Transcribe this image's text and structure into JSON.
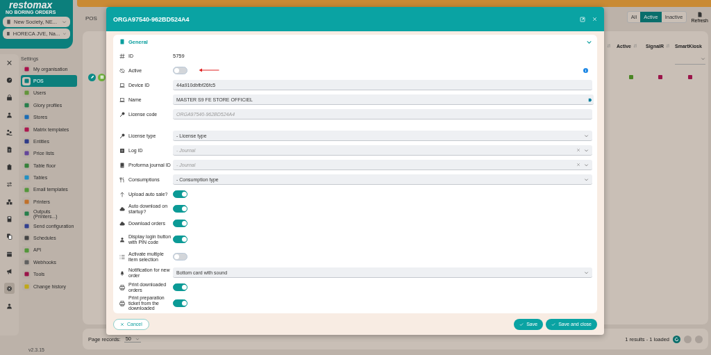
{
  "logo": {
    "name": "restomax",
    "tagline": "NO BORING ORDERS"
  },
  "selectors": [
    {
      "value": "New Society, NE..."
    },
    {
      "value": "HORECA JVE, Na..."
    }
  ],
  "rail_items": [
    {
      "selected": false
    },
    {
      "selected": false
    },
    {
      "selected": false
    },
    {
      "selected": false
    },
    {
      "selected": false
    },
    {
      "selected": false
    },
    {
      "selected": false
    },
    {
      "selected": false
    },
    {
      "selected": false
    },
    {
      "selected": false
    },
    {
      "selected": false
    },
    {
      "selected": false
    },
    {
      "selected": false
    },
    {
      "selected": true
    },
    {
      "selected": false
    }
  ],
  "nav": {
    "heading": "Settings",
    "items": [
      {
        "label": "My organisation",
        "color": "#a8104a",
        "selected": false
      },
      {
        "label": "POS",
        "color": "#0c7f7c",
        "selected": true
      },
      {
        "label": "Users",
        "color": "#62953a",
        "selected": false
      },
      {
        "label": "Glory profiles",
        "color": "#267e4b",
        "selected": false
      },
      {
        "label": "Stores",
        "color": "#1a6cb5",
        "selected": false
      },
      {
        "label": "Matrix templates",
        "color": "#ab174e",
        "selected": false
      },
      {
        "label": "Entities",
        "color": "#2e3b88",
        "selected": false
      },
      {
        "label": "Price lists",
        "color": "#64469a",
        "selected": false
      },
      {
        "label": "Table floor",
        "color": "#35803a",
        "selected": false
      },
      {
        "label": "Tables",
        "color": "#2290c2",
        "selected": false
      },
      {
        "label": "Email templates",
        "color": "#52963a",
        "selected": false
      },
      {
        "label": "Printers",
        "color": "#c0702a",
        "selected": false
      },
      {
        "label": "Outputs (Printers...)",
        "color": "#267e4b",
        "selected": false
      },
      {
        "label": "Send configuration",
        "color": "#32408f",
        "selected": false
      },
      {
        "label": "Schedules",
        "color": "#444444",
        "selected": false
      },
      {
        "label": "API",
        "color": "#52963a",
        "selected": false
      },
      {
        "label": "Webhooks",
        "color": "#606060",
        "selected": false
      },
      {
        "label": "Tools",
        "color": "#9a1449",
        "selected": false
      },
      {
        "label": "Change history",
        "color": "#c0a818",
        "selected": false
      }
    ]
  },
  "version": "v2.3.15",
  "page": {
    "tab": "POS",
    "filters": [
      {
        "label": "All",
        "selected": false
      },
      {
        "label": "Active",
        "selected": true
      },
      {
        "label": "Inactive",
        "selected": false
      }
    ],
    "refresh": "Refresh",
    "table": {
      "columns": [
        "Active",
        "SignalR",
        "SmartKiosk"
      ],
      "rows": [
        {
          "active": true,
          "signalr": false,
          "smartkiosk": false
        }
      ]
    },
    "footer": {
      "page_records_label": "Page records:",
      "page_records": "50",
      "results": "1 results - 1 loaded"
    }
  },
  "modal": {
    "title": "ORGA97540-962BD524A4",
    "section": {
      "title": "General",
      "expanded": true
    },
    "field_groups": [
      [
        {
          "kind": "static",
          "label": "ID",
          "value": "5759"
        },
        {
          "kind": "toggle",
          "label": "Active",
          "on": false,
          "info": true,
          "annotated": true
        },
        {
          "kind": "input",
          "label": "Device ID",
          "value": "44a910dbfbf26fc5"
        },
        {
          "kind": "input",
          "label": "Name",
          "value": "MASTER S9 FE STORE OFFICIEL",
          "action": true
        },
        {
          "kind": "input",
          "label": "License code",
          "placeholder": "ORGA97540-962BD524A4"
        }
      ],
      [
        {
          "kind": "select",
          "label": "License type",
          "value": "- License type"
        },
        {
          "kind": "select",
          "label": "Log ID",
          "placeholder": "- Journal",
          "clearable": true
        },
        {
          "kind": "select",
          "label": "Proforma journal ID",
          "placeholder": "- Journal",
          "clearable": true
        },
        {
          "kind": "select",
          "label": "Consumptions",
          "value": "- Consumption type"
        },
        {
          "kind": "toggle",
          "label": "Upload auto sale?",
          "on": true
        },
        {
          "kind": "toggle",
          "label": "Auto download on startup?",
          "on": true
        },
        {
          "kind": "toggle",
          "label": "Download orders",
          "on": true
        },
        {
          "kind": "toggle",
          "label": "Display login button with PIN code",
          "on": true
        },
        {
          "kind": "toggle",
          "label": "Activate multiple item selection",
          "on": false
        },
        {
          "kind": "select",
          "label": "Notification for new order",
          "value": "Bottom card with sound"
        },
        {
          "kind": "toggle",
          "label": "Print downloaded orders",
          "on": true
        },
        {
          "kind": "toggle",
          "label": "Print preparation ticket from the downloaded",
          "on": true
        }
      ]
    ],
    "buttons": {
      "cancel": "Cancel",
      "save": "Save",
      "save_close": "Save and close"
    }
  }
}
